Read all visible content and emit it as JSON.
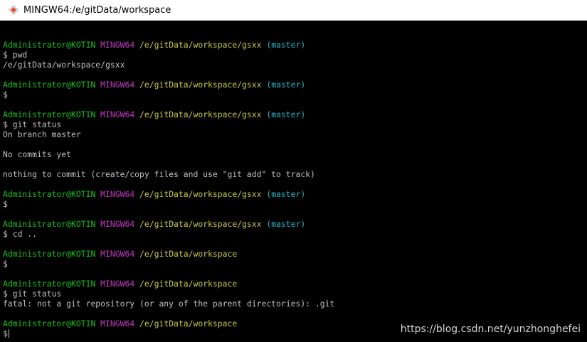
{
  "window": {
    "title": "MINGW64:/e/gitData/workspace",
    "icon": "git-diamond-icon"
  },
  "colors": {
    "user": "#17c217",
    "system": "#c13ac1",
    "path": "#c8c84a",
    "branch": "#26b6c6",
    "output": "#c0c0c0",
    "background": "#000000"
  },
  "terminal": {
    "lines": [
      {
        "user": "",
        "sys": "",
        "path": "",
        "branch": "",
        "out": ""
      },
      {
        "user": "Administrator@KOTIN",
        "sys": "MINGW64",
        "path": "/e/gitData/workspace/gsxx",
        "branch": "(master)",
        "out": ""
      },
      {
        "user": "",
        "sys": "",
        "path": "",
        "branch": "",
        "out": "$ pwd"
      },
      {
        "user": "",
        "sys": "",
        "path": "",
        "branch": "",
        "out": "/e/gitData/workspace/gsxx"
      },
      {
        "user": "",
        "sys": "",
        "path": "",
        "branch": "",
        "out": ""
      },
      {
        "user": "Administrator@KOTIN",
        "sys": "MINGW64",
        "path": "/e/gitData/workspace/gsxx",
        "branch": "(master)",
        "out": ""
      },
      {
        "user": "",
        "sys": "",
        "path": "",
        "branch": "",
        "out": "$"
      },
      {
        "user": "",
        "sys": "",
        "path": "",
        "branch": "",
        "out": ""
      },
      {
        "user": "Administrator@KOTIN",
        "sys": "MINGW64",
        "path": "/e/gitData/workspace/gsxx",
        "branch": "(master)",
        "out": ""
      },
      {
        "user": "",
        "sys": "",
        "path": "",
        "branch": "",
        "out": "$ git status"
      },
      {
        "user": "",
        "sys": "",
        "path": "",
        "branch": "",
        "out": "On branch master"
      },
      {
        "user": "",
        "sys": "",
        "path": "",
        "branch": "",
        "out": ""
      },
      {
        "user": "",
        "sys": "",
        "path": "",
        "branch": "",
        "out": "No commits yet"
      },
      {
        "user": "",
        "sys": "",
        "path": "",
        "branch": "",
        "out": ""
      },
      {
        "user": "",
        "sys": "",
        "path": "",
        "branch": "",
        "out": "nothing to commit (create/copy files and use \"git add\" to track)"
      },
      {
        "user": "",
        "sys": "",
        "path": "",
        "branch": "",
        "out": ""
      },
      {
        "user": "Administrator@KOTIN",
        "sys": "MINGW64",
        "path": "/e/gitData/workspace/gsxx",
        "branch": "(master)",
        "out": ""
      },
      {
        "user": "",
        "sys": "",
        "path": "",
        "branch": "",
        "out": "$"
      },
      {
        "user": "",
        "sys": "",
        "path": "",
        "branch": "",
        "out": ""
      },
      {
        "user": "Administrator@KOTIN",
        "sys": "MINGW64",
        "path": "/e/gitData/workspace/gsxx",
        "branch": "(master)",
        "out": ""
      },
      {
        "user": "",
        "sys": "",
        "path": "",
        "branch": "",
        "out": "$ cd .."
      },
      {
        "user": "",
        "sys": "",
        "path": "",
        "branch": "",
        "out": ""
      },
      {
        "user": "Administrator@KOTIN",
        "sys": "MINGW64",
        "path": "/e/gitData/workspace",
        "branch": "",
        "out": ""
      },
      {
        "user": "",
        "sys": "",
        "path": "",
        "branch": "",
        "out": "$"
      },
      {
        "user": "",
        "sys": "",
        "path": "",
        "branch": "",
        "out": ""
      },
      {
        "user": "Administrator@KOTIN",
        "sys": "MINGW64",
        "path": "/e/gitData/workspace",
        "branch": "",
        "out": ""
      },
      {
        "user": "",
        "sys": "",
        "path": "",
        "branch": "",
        "out": "$ git status"
      },
      {
        "user": "",
        "sys": "",
        "path": "",
        "branch": "",
        "out": "fatal: not a git repository (or any of the parent directories): .git"
      },
      {
        "user": "",
        "sys": "",
        "path": "",
        "branch": "",
        "out": ""
      },
      {
        "user": "Administrator@KOTIN",
        "sys": "MINGW64",
        "path": "/e/gitData/workspace",
        "branch": "",
        "out": ""
      },
      {
        "user": "",
        "sys": "",
        "path": "",
        "branch": "",
        "out": "$"
      }
    ],
    "cursor_line": 30
  },
  "watermark": "https://blog.csdn.net/yunzhonghefei"
}
